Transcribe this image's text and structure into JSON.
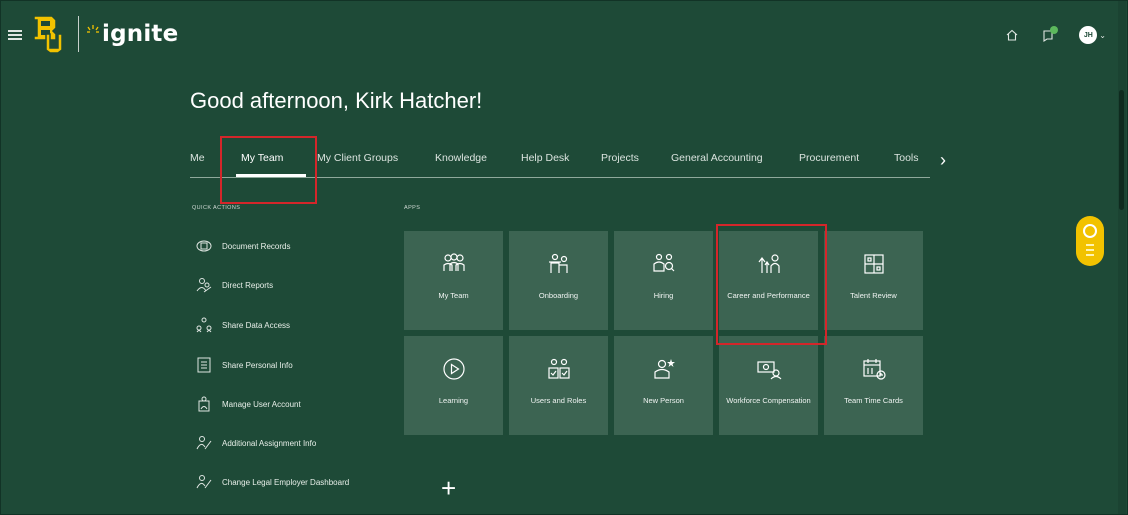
{
  "header": {
    "logo_text": "ignite",
    "icons": [
      "home-icon",
      "notifications-icon",
      "avatar"
    ],
    "avatar_initials": "JH"
  },
  "greeting": "Good afternoon, Kirk Hatcher!",
  "tabs": [
    {
      "label": "Me"
    },
    {
      "label": "My Team",
      "active": true
    },
    {
      "label": "My Client Groups"
    },
    {
      "label": "Knowledge"
    },
    {
      "label": "Help Desk"
    },
    {
      "label": "Projects"
    },
    {
      "label": "General Accounting"
    },
    {
      "label": "Procurement"
    },
    {
      "label": "Tools"
    }
  ],
  "tabs_next_label": "›",
  "quick_actions": {
    "title": "QUICK ACTIONS",
    "items": [
      {
        "label": "Document Records",
        "icon": "document-records-icon"
      },
      {
        "label": "Direct Reports",
        "icon": "direct-reports-icon"
      },
      {
        "label": "Share Data Access",
        "icon": "share-data-icon"
      },
      {
        "label": "Share Personal Info",
        "icon": "personal-info-icon"
      },
      {
        "label": "Manage User Account",
        "icon": "user-account-icon"
      },
      {
        "label": "Additional Assignment Info",
        "icon": "assignment-icon"
      },
      {
        "label": "Change Legal Employer Dashboard",
        "icon": "legal-employer-icon"
      }
    ]
  },
  "apps": {
    "title": "APPS",
    "tiles": [
      {
        "label": "My Team",
        "icon": "my-team-icon"
      },
      {
        "label": "Onboarding",
        "icon": "onboarding-icon"
      },
      {
        "label": "Hiring",
        "icon": "hiring-icon"
      },
      {
        "label": "Career and Performance",
        "icon": "career-performance-icon"
      },
      {
        "label": "Talent Review",
        "icon": "talent-review-icon"
      },
      {
        "label": "Learning",
        "icon": "learning-icon"
      },
      {
        "label": "Users and Roles",
        "icon": "users-roles-icon"
      },
      {
        "label": "New Person",
        "icon": "new-person-icon"
      },
      {
        "label": "Workforce Compensation",
        "icon": "workforce-compensation-icon"
      },
      {
        "label": "Team Time Cards",
        "icon": "time-cards-icon"
      }
    ],
    "add_label": "+"
  },
  "colors": {
    "background": "#1e4a37",
    "tile": "#3c6452",
    "highlight": "#d4262a",
    "feedback": "#f2c200"
  }
}
